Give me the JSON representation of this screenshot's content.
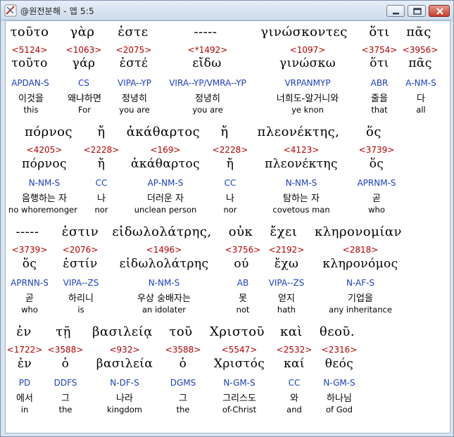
{
  "window": {
    "title": "@원전분해 - 엡 5:5",
    "icons": {
      "app": "app-icon",
      "minimize": "minimize-icon",
      "maximize": "maximize-icon",
      "close": "close-icon"
    }
  },
  "colors": {
    "strong": "#b30000",
    "parse": "#1b3fbf",
    "text": "#000000"
  },
  "rows": [
    {
      "words": [
        {
          "greek": "τοῦτο",
          "strong": "<5124>",
          "lemma": "τοῦτο",
          "parse": "APDAN-S",
          "korean": "이것을",
          "english": "this"
        },
        {
          "greek": "γὰρ",
          "strong": "<1063>",
          "lemma": "γάρ",
          "parse": "CS",
          "korean": "왜냐하면",
          "english": "For"
        },
        {
          "greek": "ἐστε",
          "strong": "<2075>",
          "lemma": "ἐστέ",
          "parse": "VIPA--YP",
          "korean": "정녕히",
          "english": "you are"
        },
        {
          "greek": "-----",
          "strong": "<*1492>",
          "lemma": "εἴδω",
          "parse": "VIRA--YP/VMRA--YP",
          "korean": "정녕히",
          "english": "you are"
        },
        {
          "greek": "γινώσκοντες",
          "strong": "<1097>",
          "lemma": "γινώσκω",
          "parse": "VRPANMYP",
          "korean": "너희도-알거니와",
          "english": "ye knon"
        },
        {
          "greek": "ὅτι",
          "strong": "<3754>",
          "lemma": "ὅτι",
          "parse": "ABR",
          "korean": "줄을",
          "english": "that"
        },
        {
          "greek": "πᾶς",
          "strong": "<3956>",
          "lemma": "πᾶς",
          "parse": "A-NM-S",
          "korean": "다",
          "english": "all"
        }
      ]
    },
    {
      "words": [
        {
          "greek": "πόρνος",
          "strong": "<4205>",
          "lemma": "πόρνος",
          "parse": "N-NM-S",
          "korean": "음행하는 자",
          "english": "no whoremonger"
        },
        {
          "greek": "ἤ",
          "strong": "<2228>",
          "lemma": "ἤ",
          "parse": "CC",
          "korean": "나",
          "english": "nor"
        },
        {
          "greek": "ἀκάθαρτος",
          "strong": "<169>",
          "lemma": "ἀκάθαρτος",
          "parse": "AP-NM-S",
          "korean": "더러운 자",
          "english": "unclean person"
        },
        {
          "greek": "ἤ",
          "strong": "<2228>",
          "lemma": "ἤ",
          "parse": "CC",
          "korean": "나",
          "english": "nor"
        },
        {
          "greek": "πλεονέκτης,",
          "strong": "<4123>",
          "lemma": "πλεονέκτης",
          "parse": "N-NM-S",
          "korean": "탐하는 자",
          "english": "covetous man"
        },
        {
          "greek": "ὅς",
          "strong": "<3739>",
          "lemma": "ὅς",
          "parse": "APRNM-S",
          "korean": "곧",
          "english": "who"
        }
      ]
    },
    {
      "words": [
        {
          "greek": "-----",
          "strong": "<3739>",
          "lemma": "ὅς",
          "parse": "APRNN-S",
          "korean": "곧",
          "english": "who"
        },
        {
          "greek": "ἐστιν",
          "strong": "<2076>",
          "lemma": "ἐστίν",
          "parse": "VIPA--ZS",
          "korean": "하리니",
          "english": "is"
        },
        {
          "greek": "εἰδωλολάτρης,",
          "strong": "<1496>",
          "lemma": "εἰδωλολάτρης",
          "parse": "N-NM-S",
          "korean": "우상 숭배자는",
          "english": "an idolater"
        },
        {
          "greek": "οὐκ",
          "strong": "<3756>",
          "lemma": "ού",
          "parse": "AB",
          "korean": "못",
          "english": "not"
        },
        {
          "greek": "ἔχει",
          "strong": "<2192>",
          "lemma": "ἔχω",
          "parse": "VIPA--ZS",
          "korean": "얻지",
          "english": "hath"
        },
        {
          "greek": "κληρονομίαν",
          "strong": "<2818>",
          "lemma": "κληρονόμος",
          "parse": "N-AF-S",
          "korean": "기업을",
          "english": "any inheritance"
        }
      ]
    },
    {
      "words": [
        {
          "greek": "ἐν",
          "strong": "<1722>",
          "lemma": "ἐν",
          "parse": "PD",
          "korean": "에서",
          "english": "in"
        },
        {
          "greek": "τῇ",
          "strong": "<3588>",
          "lemma": "ὁ",
          "parse": "DDFS",
          "korean": "그",
          "english": "the"
        },
        {
          "greek": "βασιλείᾳ",
          "strong": "<932>",
          "lemma": "βασιλεία",
          "parse": "N-DF-S",
          "korean": "나라",
          "english": "kingdom"
        },
        {
          "greek": "τοῦ",
          "strong": "<3588>",
          "lemma": "ὁ",
          "parse": "DGMS",
          "korean": "그",
          "english": "the"
        },
        {
          "greek": "Χριστοῦ",
          "strong": "<5547>",
          "lemma": "Χριστός",
          "parse": "N-GM-S",
          "korean": "그리스도",
          "english": "of-Christ"
        },
        {
          "greek": "καὶ",
          "strong": "<2532>",
          "lemma": "καί",
          "parse": "CC",
          "korean": "와",
          "english": "and"
        },
        {
          "greek": "θεοῦ.",
          "strong": "<2316>",
          "lemma": "θεός",
          "parse": "N-GM-S",
          "korean": "하나님",
          "english": "of God"
        }
      ]
    }
  ]
}
